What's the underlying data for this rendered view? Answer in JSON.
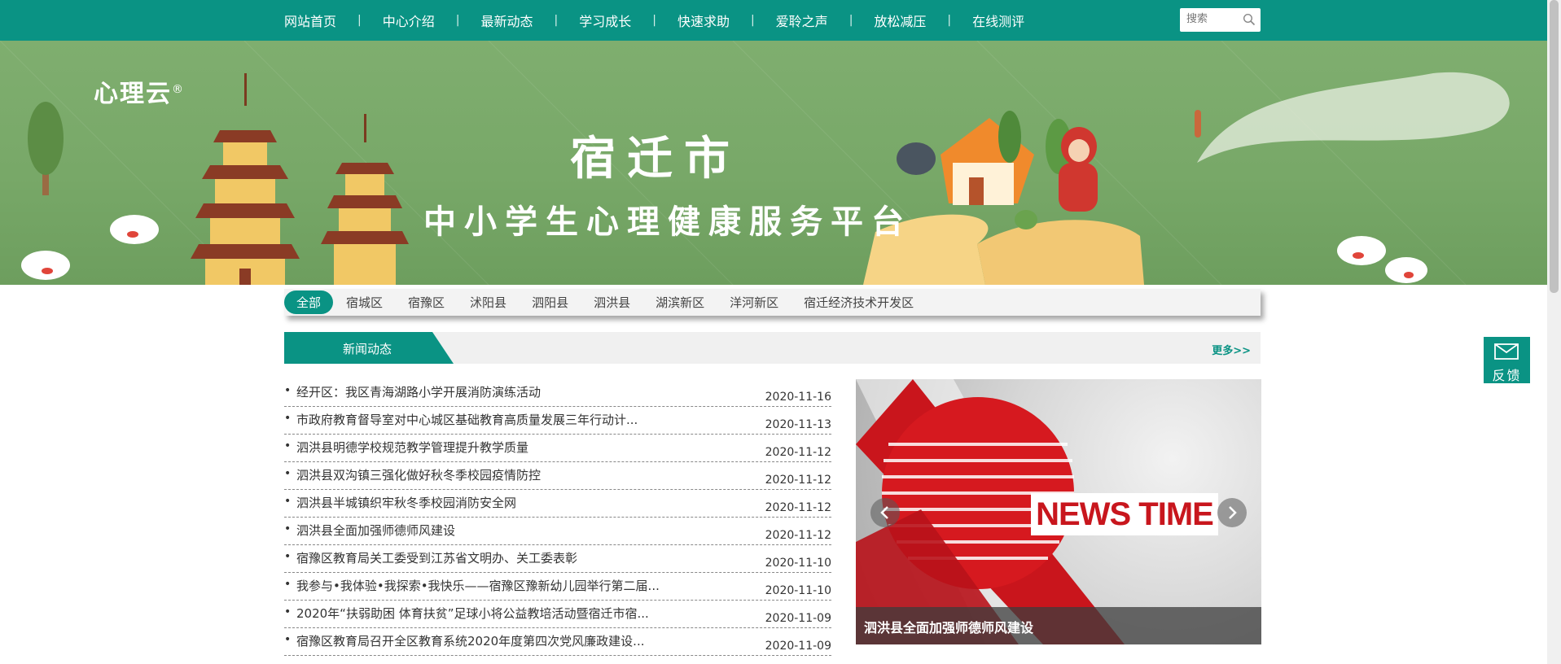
{
  "nav": {
    "items": [
      "网站首页",
      "中心介绍",
      "最新动态",
      "学习成长",
      "快速求助",
      "爱聆之声",
      "放松减压",
      "在线测评"
    ],
    "separator": "|",
    "search_placeholder": "搜索"
  },
  "banner": {
    "logo": "心理云",
    "logo_mark": "®",
    "city": "宿迁市",
    "subtitle": "中小学生心理健康服务平台"
  },
  "districts": {
    "items": [
      "全部",
      "宿城区",
      "宿豫区",
      "沭阳县",
      "泗阳县",
      "泗洪县",
      "湖滨新区",
      "洋河新区",
      "宿迁经济技术开发区"
    ],
    "active_index": 0
  },
  "news": {
    "header": "新闻动态",
    "more": "更多>>",
    "items": [
      {
        "title": "经开区：我区青海湖路小学开展消防演练活动",
        "date": "2020-11-16"
      },
      {
        "title": "市政府教育督导室对中心城区基础教育高质量发展三年行动计...",
        "date": "2020-11-13"
      },
      {
        "title": "泗洪县明德学校规范教学管理提升教学质量",
        "date": "2020-11-12"
      },
      {
        "title": "泗洪县双沟镇三强化做好秋冬季校园疫情防控",
        "date": "2020-11-12"
      },
      {
        "title": "泗洪县半城镇织牢秋冬季校园消防安全网",
        "date": "2020-11-12"
      },
      {
        "title": "泗洪县全面加强师德师风建设",
        "date": "2020-11-12"
      },
      {
        "title": "宿豫区教育局关工委受到江苏省文明办、关工委表彰",
        "date": "2020-11-10"
      },
      {
        "title": "我参与•我体验•我探索•我快乐——宿豫区豫新幼儿园举行第二届...",
        "date": "2020-11-10"
      },
      {
        "title": "2020年“扶弱助困 体育扶贫”足球小将公益教培活动暨宿迁市宿...",
        "date": "2020-11-09"
      },
      {
        "title": "宿豫区教育局召开全区教育系统2020年度第四次党风廉政建设...",
        "date": "2020-11-09"
      }
    ]
  },
  "carousel": {
    "image_text": "NEWS TIME",
    "caption": "泗洪县全面加强师德师风建设",
    "prev_icon": "chevron-left-icon",
    "next_icon": "chevron-right-icon"
  },
  "feedback": {
    "label": "反馈",
    "icon": "envelope-icon"
  },
  "colors": {
    "primary": "#0a9384",
    "banner_green": "#7fae6f",
    "news_red": "#c8161d"
  }
}
